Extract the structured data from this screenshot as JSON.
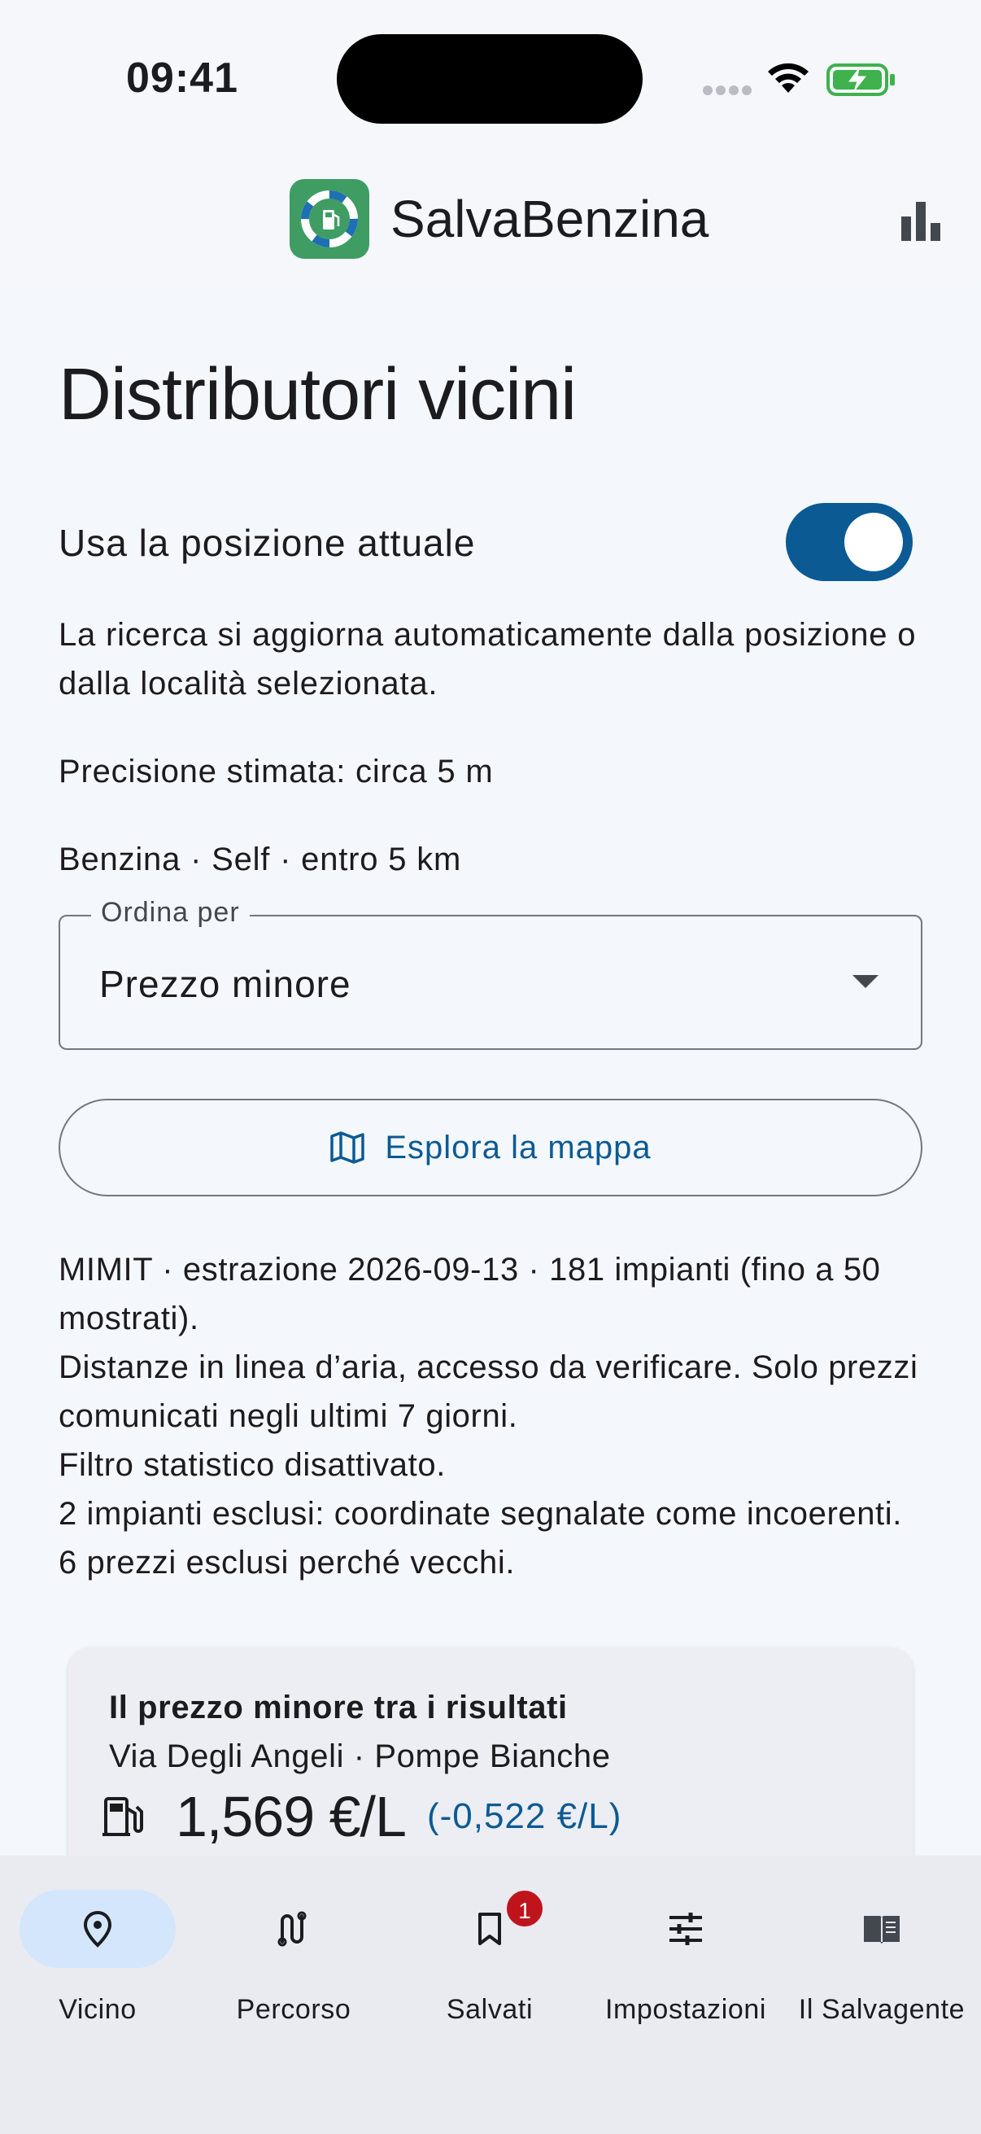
{
  "status_bar": {
    "time": "09:41"
  },
  "app_bar": {
    "title": "SalvaBenzina"
  },
  "page": {
    "title": "Distributori vicini",
    "use_location_label": "Usa la posizione attuale",
    "use_location_enabled": true,
    "auto_update_text": "La ricerca si aggiorna automaticamente dalla posizione o dalla località selezionata.",
    "precision_text": "Precisione stimata: circa 5 m",
    "filter_summary": "Benzina · Self · entro 5 km",
    "sort": {
      "label": "Ordina per",
      "value": "Prezzo minore"
    },
    "map_button_label": "Esplora la mappa",
    "info_lines": [
      "MIMIT · estrazione 2026-09-13 · 181 impianti (fino a 50 mostrati).",
      "Distanze in linea d’aria, accesso da verificare. Solo prezzi comunicati negli ultimi 7 giorni.",
      "Filtro statistico disattivato.",
      "2 impianti esclusi: coordinate segnalate come incoerenti.",
      "6 prezzi esclusi perché vecchi."
    ]
  },
  "best_card": {
    "title": "Il prezzo minore tra i risultati",
    "subtitle": "Via Degli Angeli · Pompe Bianche",
    "price": "1,569 €/L",
    "delta": "(-0,522 €/L)"
  },
  "bottom_nav": {
    "items": [
      {
        "label": "Vicino",
        "icon": "location-pin-icon",
        "active": true
      },
      {
        "label": "Percorso",
        "icon": "route-icon",
        "active": false
      },
      {
        "label": "Salvati",
        "icon": "bookmark-icon",
        "active": false,
        "badge": "1"
      },
      {
        "label": "Impostazioni",
        "icon": "tune-icon",
        "active": false
      },
      {
        "label": "Il Salvagente",
        "icon": "book-icon",
        "active": false
      }
    ]
  },
  "colors": {
    "accent": "#0b5a94",
    "brand": "#3f9d63",
    "badge": "#c0141c",
    "active_pill": "#d4e6fb"
  }
}
